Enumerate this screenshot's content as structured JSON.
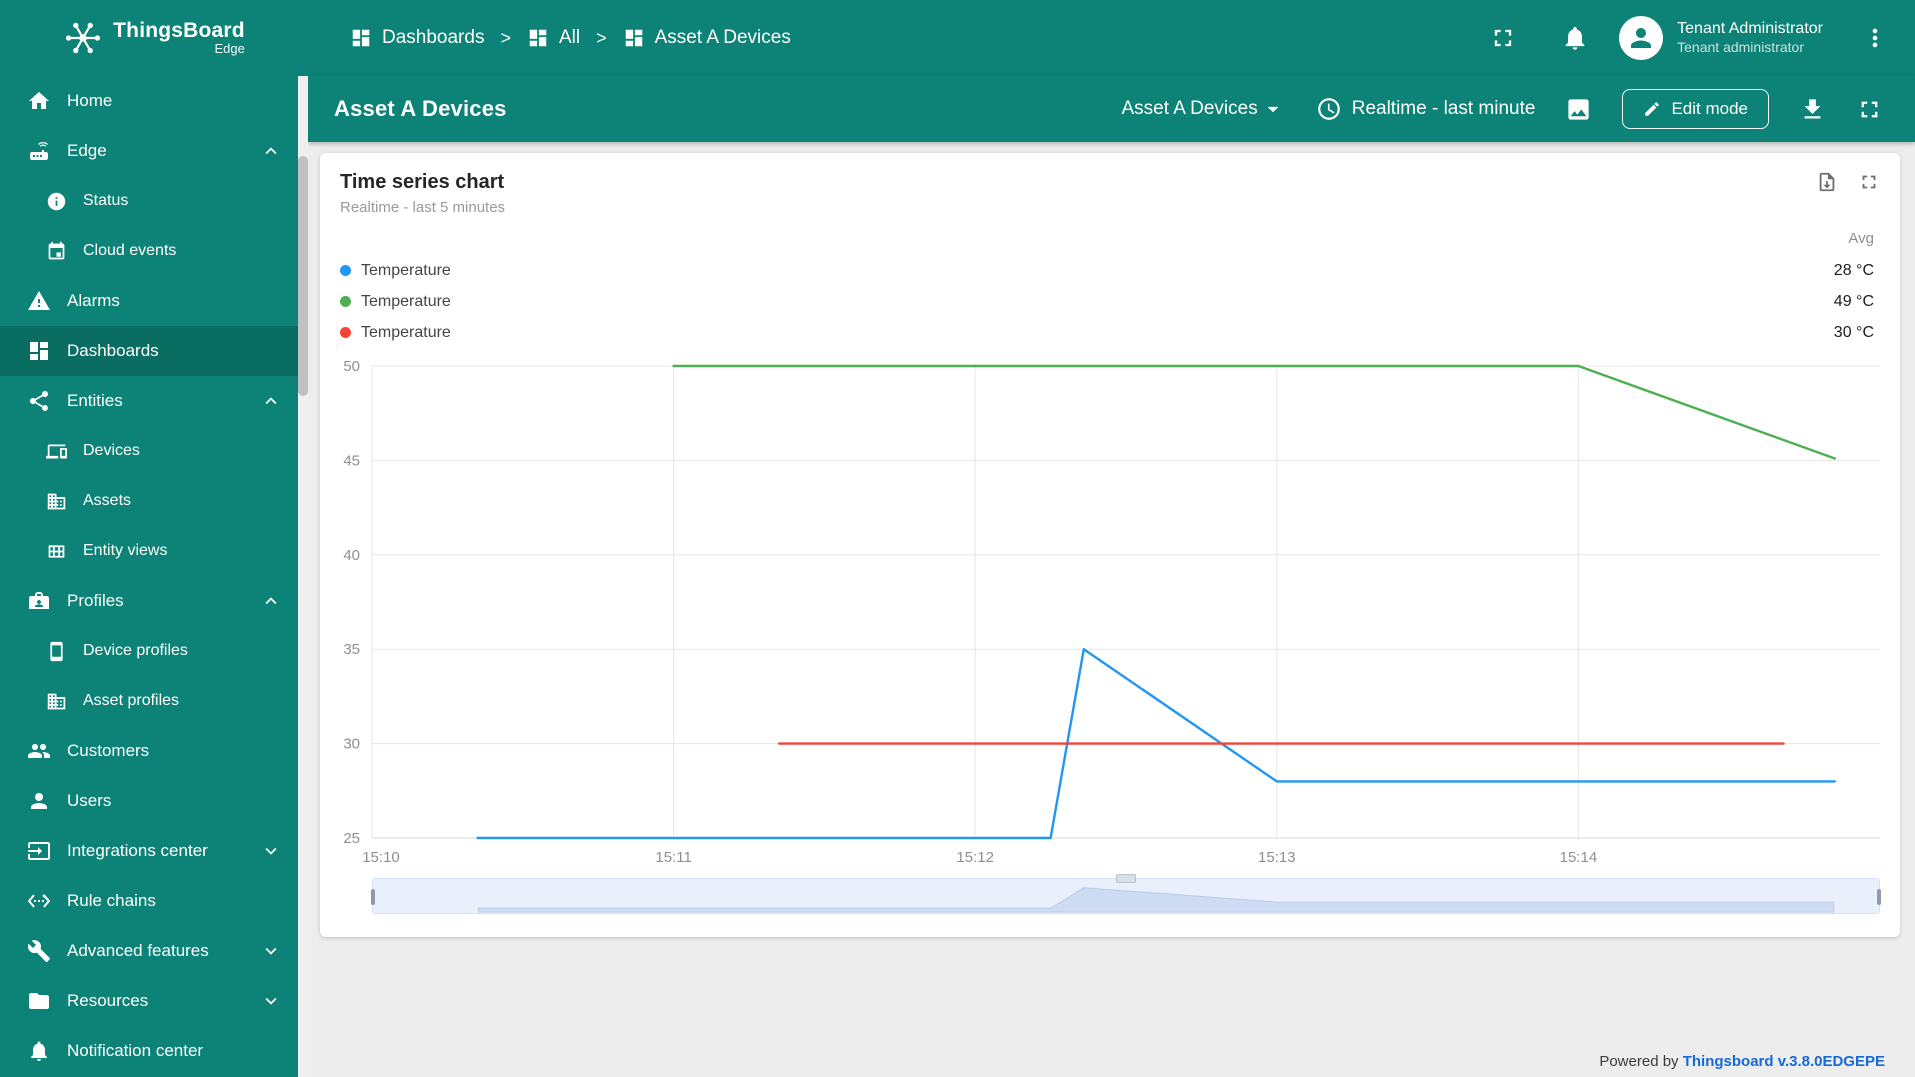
{
  "app": {
    "brand_title": "ThingsBoard",
    "brand_subtitle": "Edge"
  },
  "sidebar": {
    "items": [
      {
        "label": "Home"
      },
      {
        "label": "Edge"
      },
      {
        "label": "Status"
      },
      {
        "label": "Cloud events"
      },
      {
        "label": "Alarms"
      },
      {
        "label": "Dashboards"
      },
      {
        "label": "Entities"
      },
      {
        "label": "Devices"
      },
      {
        "label": "Assets"
      },
      {
        "label": "Entity views"
      },
      {
        "label": "Profiles"
      },
      {
        "label": "Device profiles"
      },
      {
        "label": "Asset profiles"
      },
      {
        "label": "Customers"
      },
      {
        "label": "Users"
      },
      {
        "label": "Integrations center"
      },
      {
        "label": "Rule chains"
      },
      {
        "label": "Advanced features"
      },
      {
        "label": "Resources"
      },
      {
        "label": "Notification center"
      }
    ]
  },
  "breadcrumb": {
    "items": [
      {
        "label": "Dashboards"
      },
      {
        "label": "All"
      },
      {
        "label": "Asset A Devices"
      }
    ],
    "separator": ">"
  },
  "header": {
    "user_name": "Tenant Administrator",
    "user_role": "Tenant administrator"
  },
  "toolbar": {
    "title": "Asset A Devices",
    "entity_select": "Asset A Devices",
    "timewindow": "Realtime - last minute",
    "edit_label": "Edit mode"
  },
  "widget": {
    "title": "Time series chart",
    "subtitle": "Realtime - last 5 minutes",
    "avg_label": "Avg"
  },
  "chart_data": {
    "type": "line",
    "title": "Time series chart",
    "subtitle": "Realtime - last 5 minutes",
    "legend_position": "top",
    "grid": true,
    "x_ticks": [
      "15:10",
      "15:11",
      "15:12",
      "15:13",
      "15:14"
    ],
    "x_tick_values": [
      0,
      1,
      2,
      3,
      4
    ],
    "xlim": [
      0,
      5
    ],
    "y_ticks": [
      25,
      30,
      35,
      40,
      45,
      50
    ],
    "ylim": [
      25,
      50
    ],
    "series": [
      {
        "name": "Temperature",
        "color": "#2196f3",
        "avg": "28 °C",
        "points": [
          [
            0.35,
            25
          ],
          [
            2.25,
            25
          ],
          [
            2.36,
            35
          ],
          [
            3.0,
            28
          ],
          [
            4.85,
            28
          ]
        ]
      },
      {
        "name": "Temperature",
        "color": "#4caf50",
        "avg": "49 °C",
        "points": [
          [
            1.0,
            50
          ],
          [
            4.0,
            50
          ],
          [
            4.85,
            45.1
          ]
        ]
      },
      {
        "name": "Temperature",
        "color": "#f44336",
        "avg": "30 °C",
        "points": [
          [
            1.35,
            30
          ],
          [
            4.68,
            30
          ]
        ]
      }
    ]
  },
  "footer": {
    "powered_by": "Powered by",
    "version": "Thingsboard v.3.8.0EDGEPE"
  }
}
